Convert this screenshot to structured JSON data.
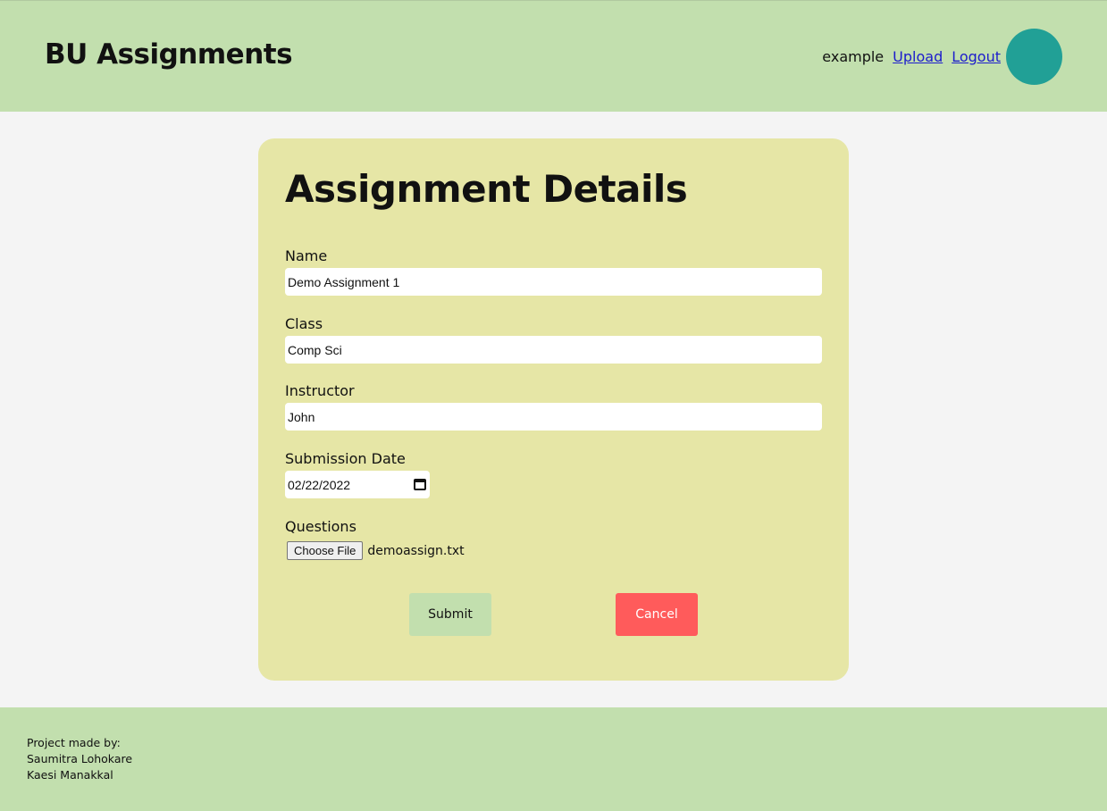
{
  "header": {
    "title": "BU Assignments",
    "username": "example",
    "upload_link": "Upload",
    "logout_link": "Logout",
    "avatar_color": "#21a096"
  },
  "form": {
    "title": "Assignment Details",
    "name_label": "Name",
    "name_value": "Demo Assignment 1",
    "class_label": "Class",
    "class_value": "Comp Sci",
    "instructor_label": "Instructor",
    "instructor_value": "John",
    "date_label": "Submission Date",
    "date_value": "02/22/2022",
    "questions_label": "Questions",
    "file_button": "Choose File",
    "file_name": "demoassign.txt",
    "submit_label": "Submit",
    "cancel_label": "Cancel"
  },
  "footer": {
    "line1": "Project made by:",
    "line2": "Saumitra Lohokare",
    "line3": "Kaesi Manakkal"
  },
  "colors": {
    "header_bg": "#c2dfae",
    "card_bg": "#e6e6a6",
    "cancel_bg": "#ff5b5b",
    "page_bg": "#f4f4f4"
  }
}
